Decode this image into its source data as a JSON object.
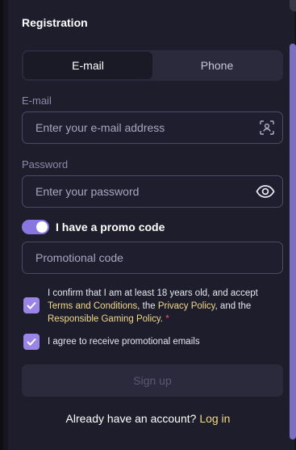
{
  "title": "Registration",
  "tabs": [
    {
      "label": "E-mail",
      "active": true
    },
    {
      "label": "Phone",
      "active": false
    }
  ],
  "email": {
    "label": "E-mail",
    "placeholder": "Enter your e-mail address",
    "icon": "contact-scan-icon"
  },
  "password": {
    "label": "Password",
    "placeholder": "Enter your password",
    "icon": "eye-icon"
  },
  "promo": {
    "toggle_label": "I have a promo code",
    "toggle_on": true,
    "placeholder": "Promotional code"
  },
  "consent": {
    "text_1": "I confirm that I am at least 18 years old, and accept ",
    "terms_link": "Terms and Conditions",
    "text_2": ", the ",
    "privacy_link": "Privacy Policy",
    "text_3": ", and the ",
    "gaming_link": "Responsible Gaming Policy",
    "text_4": ".",
    "required_mark": "*",
    "checked": true
  },
  "promo_emails": {
    "label": "I agree to receive promotional emails",
    "checked": true
  },
  "signup_label": "Sign up",
  "login": {
    "prompt": "Already have an account?",
    "link": "Log in"
  },
  "colors": {
    "accent": "#9a85e6",
    "link": "#f2d98a",
    "background": "#1e1d2c"
  }
}
